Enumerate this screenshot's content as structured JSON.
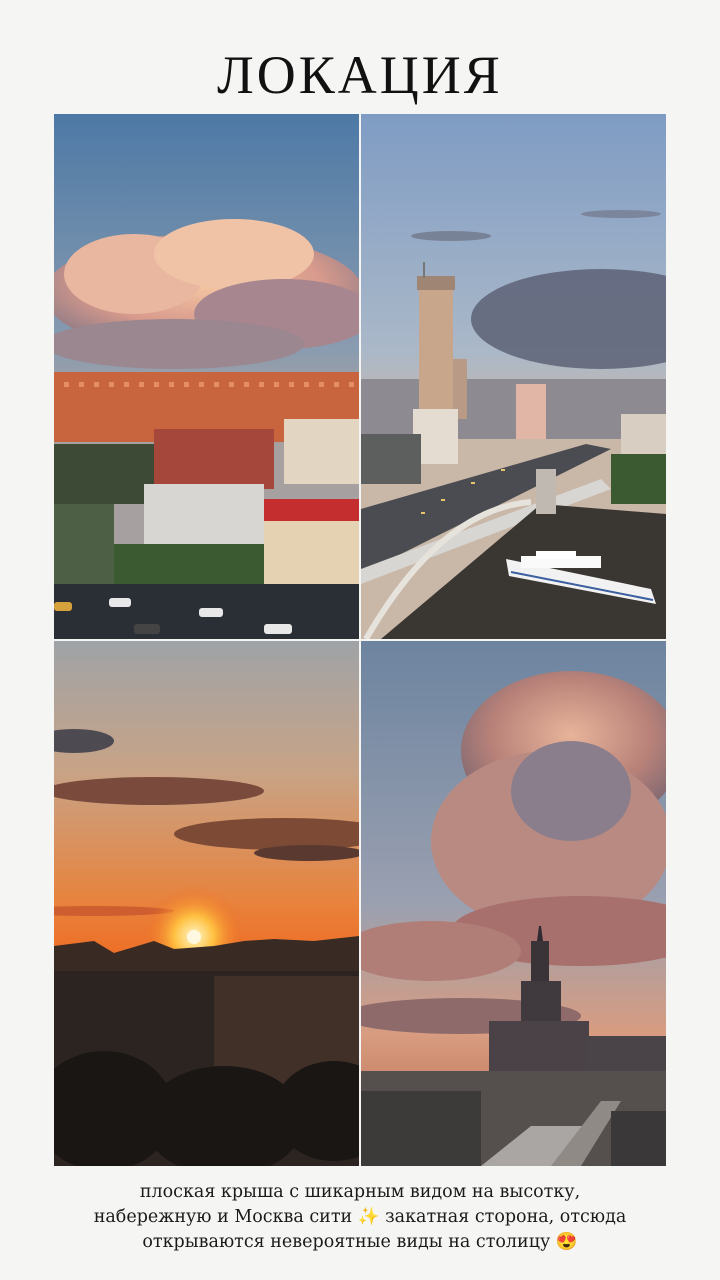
{
  "title": "ЛОКАЦИЯ",
  "photos": [
    {
      "name": "photo-clouds-buildings"
    },
    {
      "name": "photo-bridge-river"
    },
    {
      "name": "photo-sunset"
    },
    {
      "name": "photo-stalin-skyscraper"
    }
  ],
  "caption": {
    "line1": "плоская крыша с шикарным видом на высотку,",
    "line2": "набережную и Москва сити ✨ закатная сторона, отсюда",
    "line3": "открываются невероятные виды на столицу 😍"
  }
}
